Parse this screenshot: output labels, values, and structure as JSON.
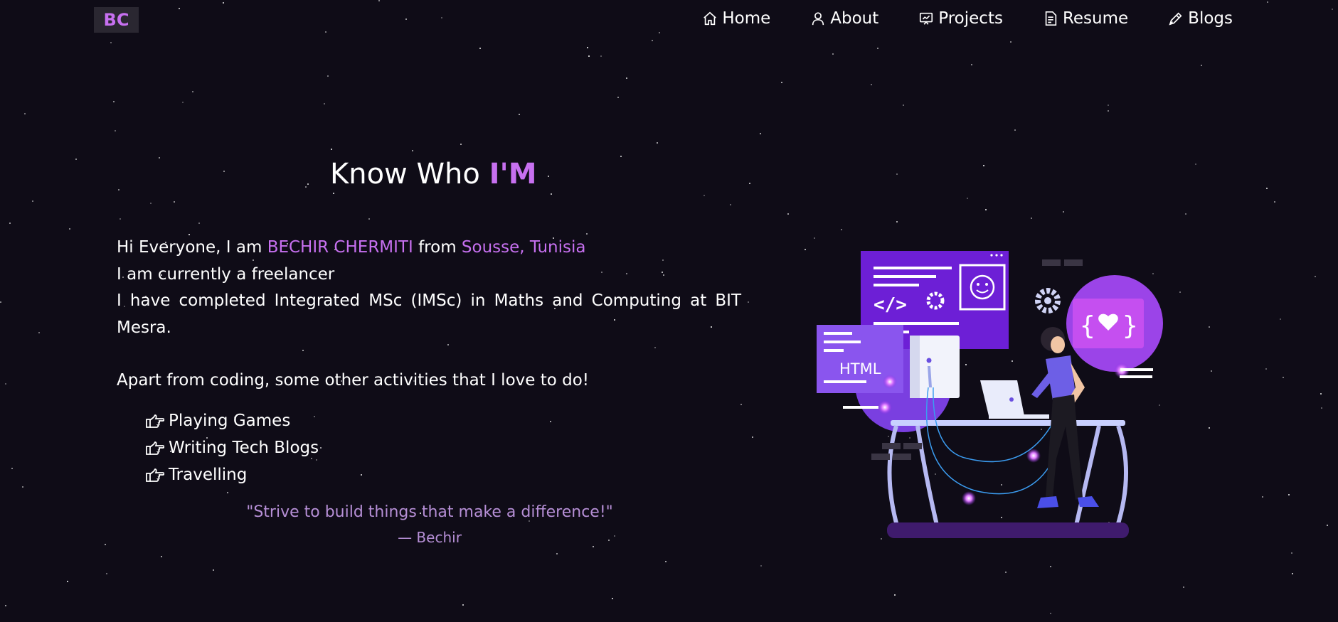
{
  "brand": {
    "logo_text": "BC",
    "accent_color": "#c770f0",
    "background_color": "#0f0c17"
  },
  "nav": {
    "items": [
      {
        "label": "Home",
        "icon": "home-icon"
      },
      {
        "label": "About",
        "icon": "user-icon"
      },
      {
        "label": "Projects",
        "icon": "projects-icon"
      },
      {
        "label": "Resume",
        "icon": "document-icon"
      },
      {
        "label": "Blogs",
        "icon": "pen-icon"
      }
    ]
  },
  "about": {
    "heading_prefix": "Know Who",
    "heading_accent": "I'M",
    "greeting_prefix": "Hi Everyone, I am",
    "name": "BECHIR CHERMITI",
    "from_word": "from",
    "location": "Sousse, Tunisia",
    "line_freelancer": "I am currently a freelancer",
    "line_education": "I have completed Integrated MSc (IMSc) in Maths and Computing at BIT Mesra.",
    "activities_intro": "Apart from coding, some other activities that I love to do!",
    "activities": [
      {
        "label": "Playing Games",
        "icon": "hand-point-right-icon"
      },
      {
        "label": "Writing Tech Blogs",
        "icon": "hand-point-right-icon"
      },
      {
        "label": "Travelling",
        "icon": "hand-point-right-icon"
      }
    ],
    "quote": "\"Strive to build things that make a difference!\"",
    "quote_author": "— Bechir"
  },
  "illustration": {
    "html_label": "HTML",
    "code_symbol": "</>",
    "braces_symbol": "{",
    "braces_symbol_close": "}"
  }
}
